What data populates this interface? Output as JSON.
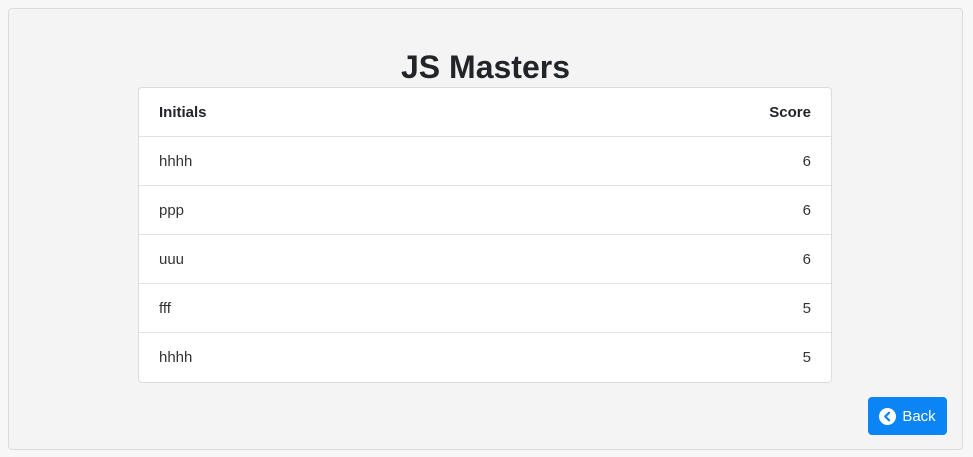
{
  "title": "JS Masters",
  "table": {
    "headers": {
      "initials": "Initials",
      "score": "Score"
    },
    "rows": [
      {
        "initials": "hhhh",
        "score": "6"
      },
      {
        "initials": "ppp",
        "score": "6"
      },
      {
        "initials": "uuu",
        "score": "6"
      },
      {
        "initials": "fff",
        "score": "5"
      },
      {
        "initials": "hhhh",
        "score": "5"
      }
    ]
  },
  "back_button": {
    "label": "Back",
    "icon": "chevron-left-circle-icon"
  },
  "colors": {
    "accent": "#0b84f5",
    "background": "#f4f4f4"
  }
}
